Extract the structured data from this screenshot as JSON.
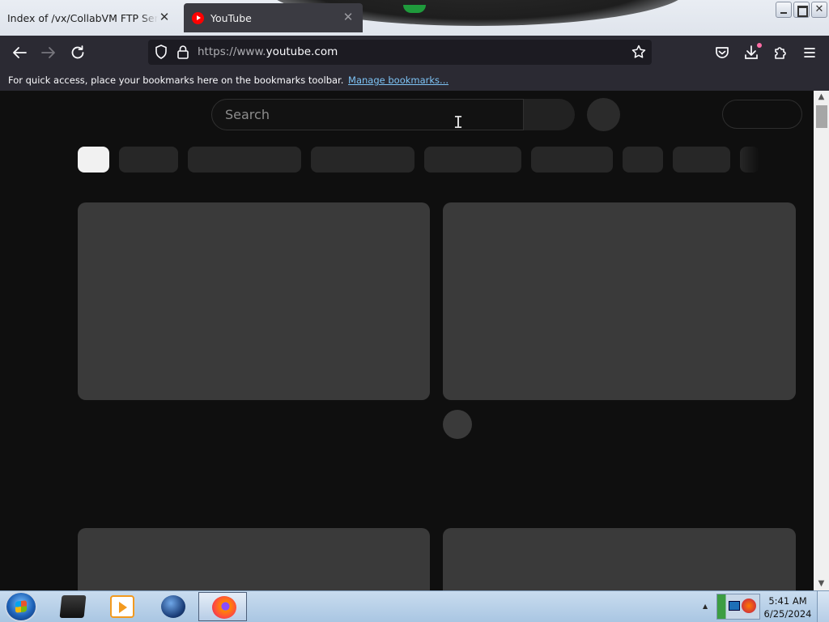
{
  "browser": {
    "tabs": [
      {
        "title": "Index of /vx/CollabVM FTP Server M",
        "active": false,
        "icon": "none"
      },
      {
        "title": "YouTube",
        "active": true,
        "icon": "youtube-favicon"
      }
    ],
    "close_glyph": "✕",
    "window_controls": {
      "close_glyph": "✕"
    },
    "url_scheme_host": "https://www.",
    "url_domain": "youtube.com",
    "bookmarks_message": "For quick access, place your bookmarks here on the bookmarks toolbar.",
    "bookmarks_link": "Manage bookmarks..."
  },
  "youtube": {
    "search_placeholder": "Search",
    "chips_count_visible": 9,
    "state": "loading-skeleton"
  },
  "scrollbar": {
    "up_glyph": "▲",
    "down_glyph": "▼"
  },
  "taskbar": {
    "time": "5:41 AM",
    "date": "6/25/2024",
    "tray_arrow": "▲",
    "apps": [
      "vm-console-icon",
      "media-player-icon",
      "globe-icon",
      "firefox-icon"
    ]
  },
  "colors": {
    "page_bg": "#0f0f0f",
    "skeleton": "#3a3a3a",
    "chip": "#272727",
    "chip_active": "#f1f1f1",
    "toolbar": "#2b2a33",
    "link": "#7dc3f5"
  }
}
